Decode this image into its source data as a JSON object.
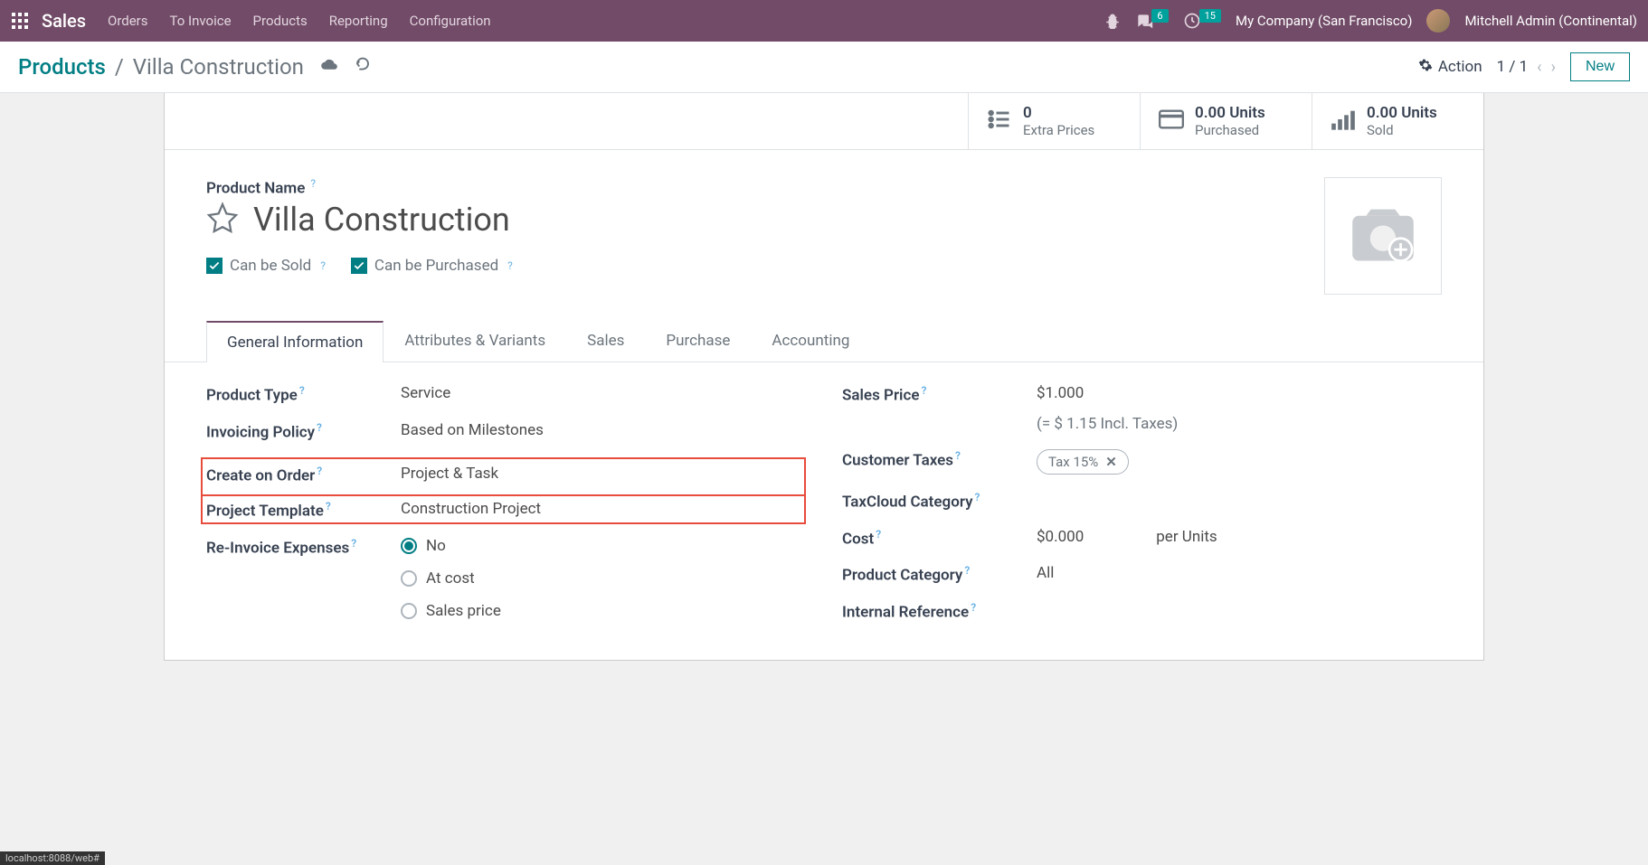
{
  "nav": {
    "brand": "Sales",
    "items": [
      "Orders",
      "To Invoice",
      "Products",
      "Reporting",
      "Configuration"
    ],
    "chat_badge": "6",
    "activity_badge": "15",
    "company": "My Company (San Francisco)",
    "user": "Mitchell Admin (Continental)"
  },
  "breadcrumb": {
    "root": "Products",
    "current": "Villa Construction",
    "action_label": "Action",
    "pager": "1 / 1",
    "new_label": "New"
  },
  "stats": {
    "extra_prices": {
      "value": "0",
      "label": "Extra Prices"
    },
    "purchased": {
      "value": "0.00 Units",
      "label": "Purchased"
    },
    "sold": {
      "value": "0.00 Units",
      "label": "Sold"
    }
  },
  "title": {
    "product_name_label": "Product Name",
    "product_name": "Villa Construction",
    "can_be_sold": "Can be Sold",
    "can_be_purchased": "Can be Purchased"
  },
  "tabs": [
    "General Information",
    "Attributes & Variants",
    "Sales",
    "Purchase",
    "Accounting"
  ],
  "form": {
    "left": {
      "product_type": {
        "label": "Product Type",
        "value": "Service"
      },
      "invoicing_policy": {
        "label": "Invoicing Policy",
        "value": "Based on Milestones"
      },
      "create_on_order": {
        "label": "Create on Order",
        "value": "Project & Task"
      },
      "project_template": {
        "label": "Project Template",
        "value": "Construction Project"
      },
      "reinvoice": {
        "label": "Re-Invoice Expenses",
        "options": [
          "No",
          "At cost",
          "Sales price"
        ],
        "selected": "No"
      }
    },
    "right": {
      "sales_price": {
        "label": "Sales Price",
        "value": "$1.000",
        "incl": "(= $ 1.15 Incl. Taxes)"
      },
      "customer_taxes": {
        "label": "Customer Taxes",
        "tag": "Tax 15%"
      },
      "taxcloud": {
        "label": "TaxCloud Category"
      },
      "cost": {
        "label": "Cost",
        "value": "$0.000",
        "per": "per Units"
      },
      "product_category": {
        "label": "Product Category",
        "value": "All"
      },
      "internal_ref": {
        "label": "Internal Reference"
      }
    }
  },
  "footer_status": "localhost:8088/web#"
}
